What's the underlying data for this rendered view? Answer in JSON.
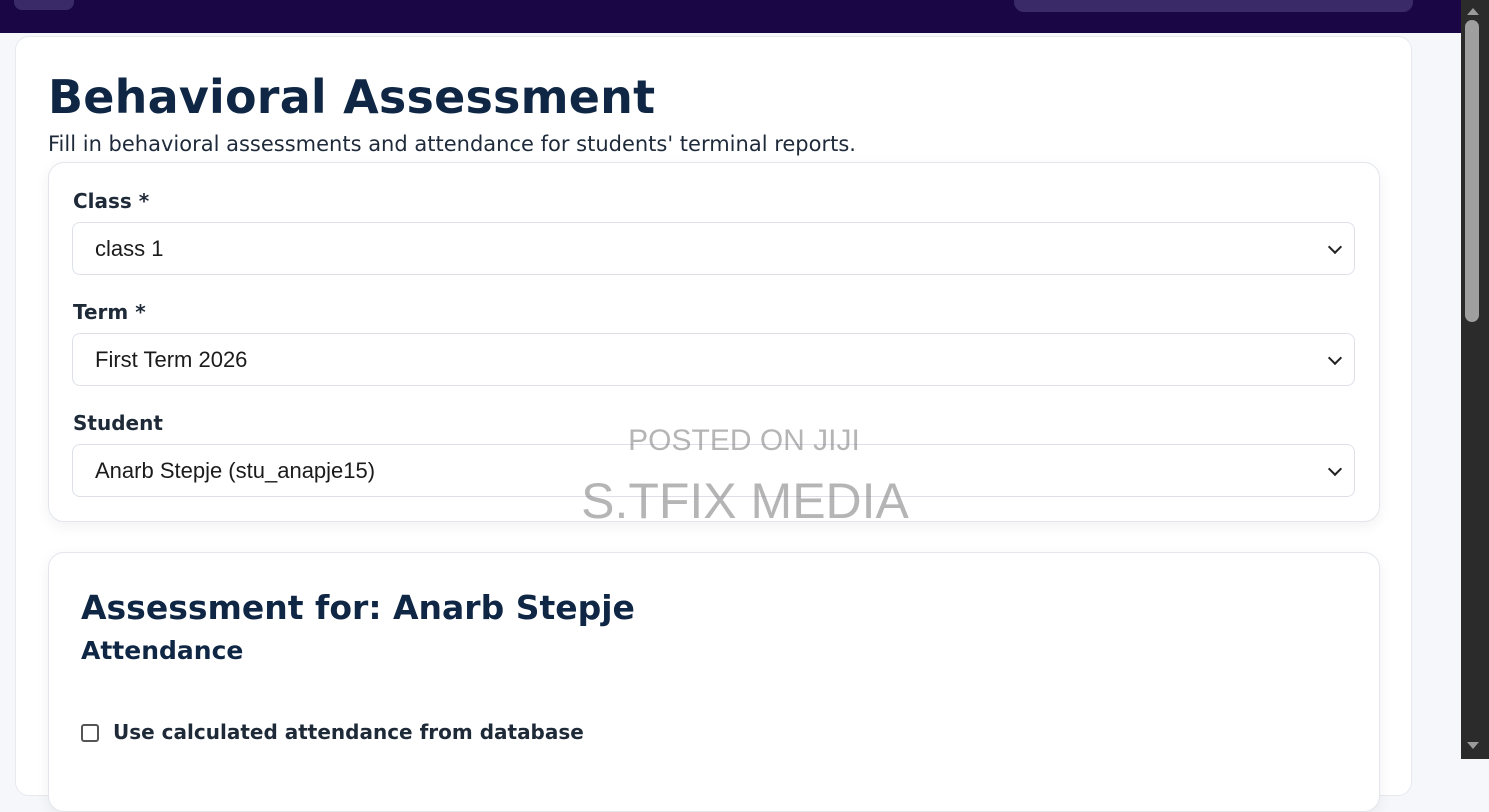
{
  "page": {
    "title": "Behavioral Assessment",
    "subtitle": "Fill in behavioral assessments and attendance for students' terminal reports."
  },
  "filters": {
    "class_label": "Class *",
    "class_value": "class 1",
    "term_label": "Term *",
    "term_value": "First Term 2026",
    "student_label": "Student",
    "student_value": "Anarb Stepje (stu_anapje15)"
  },
  "assessment": {
    "title": "Assessment for: Anarb Stepje",
    "attendance_heading": "Attendance",
    "use_calculated_label": "Use calculated attendance from database",
    "use_calculated_checked": false
  },
  "watermark": {
    "line1": "POSTED ON JIJI",
    "line2": "S.TFIX MEDIA"
  },
  "colors": {
    "topbar": "#1a0545",
    "heading": "#0f2744",
    "background": "#f5f7fa"
  }
}
